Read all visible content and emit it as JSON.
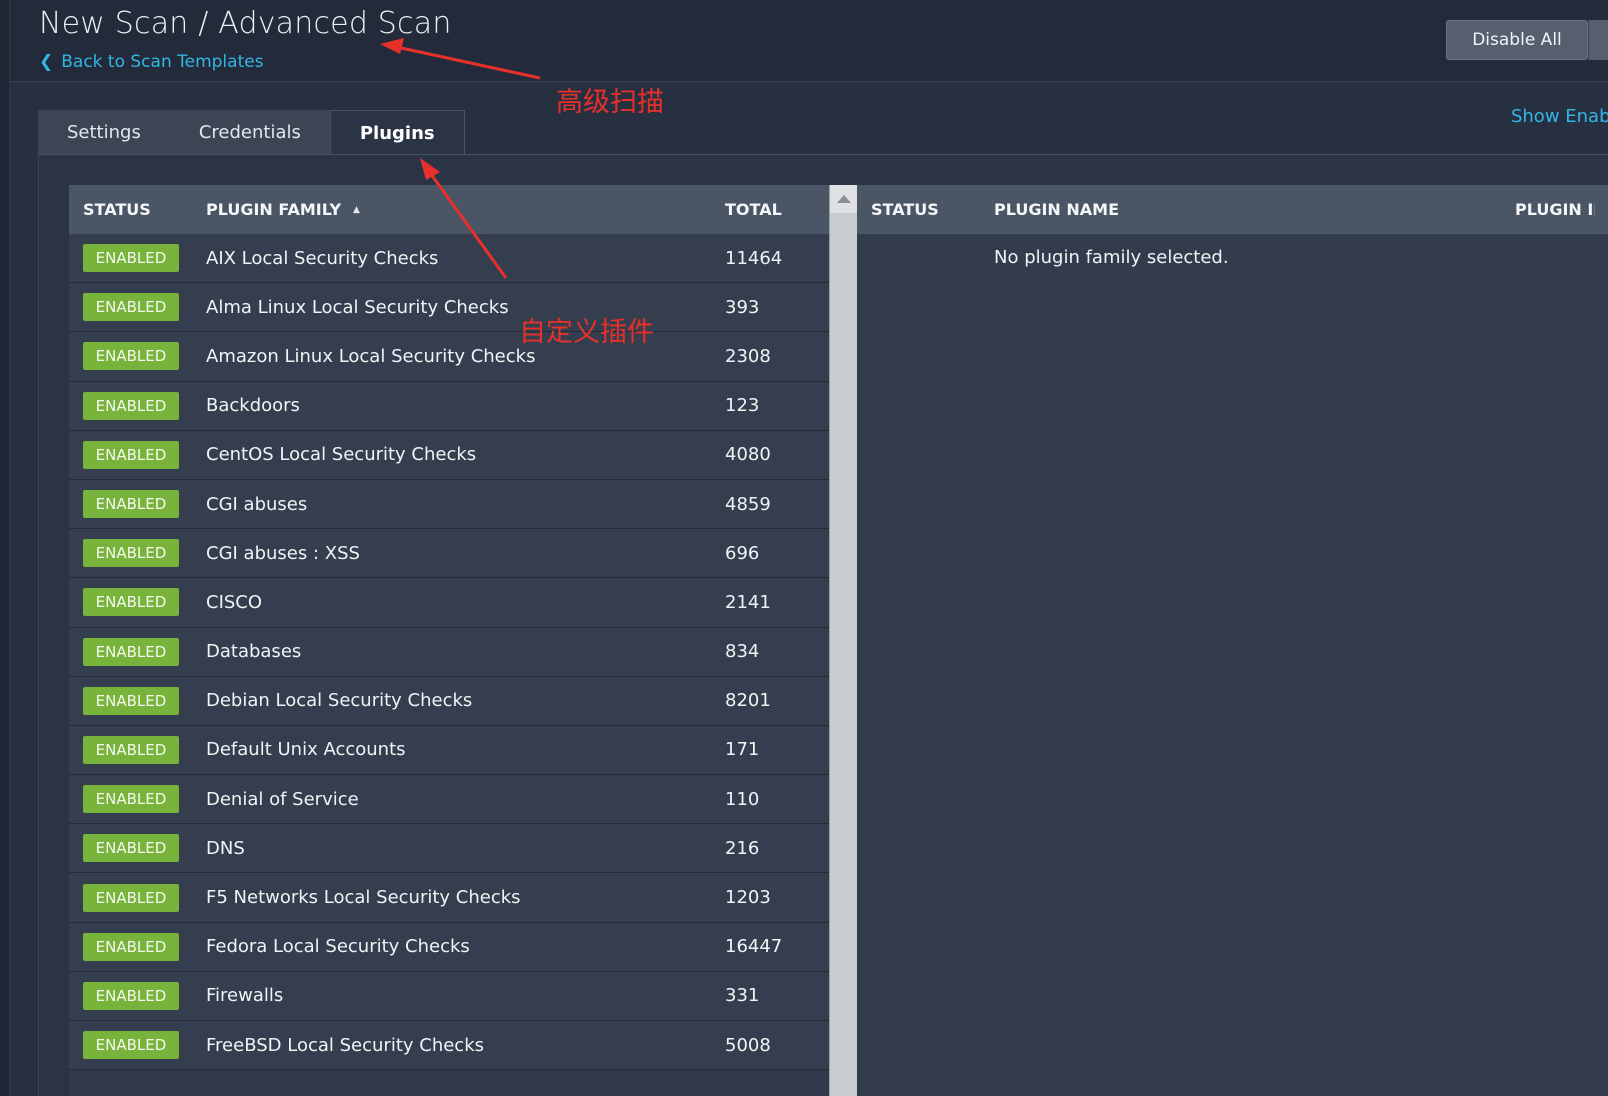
{
  "header": {
    "title": "New Scan / Advanced Scan",
    "back_link": "Back to Scan Templates",
    "disable_all": "Disable All"
  },
  "tabs": [
    {
      "label": "Settings",
      "active": false
    },
    {
      "label": "Credentials",
      "active": false
    },
    {
      "label": "Plugins",
      "active": true
    }
  ],
  "show_enabled": "Show Enabled",
  "families_table": {
    "columns": {
      "status": "STATUS",
      "family": "PLUGIN FAMILY",
      "total": "TOTAL"
    },
    "sort": "ascending",
    "rows": [
      {
        "status": "ENABLED",
        "family": "AIX Local Security Checks",
        "total": "11464"
      },
      {
        "status": "ENABLED",
        "family": "Alma Linux Local Security Checks",
        "total": "393"
      },
      {
        "status": "ENABLED",
        "family": "Amazon Linux Local Security Checks",
        "total": "2308"
      },
      {
        "status": "ENABLED",
        "family": "Backdoors",
        "total": "123"
      },
      {
        "status": "ENABLED",
        "family": "CentOS Local Security Checks",
        "total": "4080"
      },
      {
        "status": "ENABLED",
        "family": "CGI abuses",
        "total": "4859"
      },
      {
        "status": "ENABLED",
        "family": "CGI abuses : XSS",
        "total": "696"
      },
      {
        "status": "ENABLED",
        "family": "CISCO",
        "total": "2141"
      },
      {
        "status": "ENABLED",
        "family": "Databases",
        "total": "834"
      },
      {
        "status": "ENABLED",
        "family": "Debian Local Security Checks",
        "total": "8201"
      },
      {
        "status": "ENABLED",
        "family": "Default Unix Accounts",
        "total": "171"
      },
      {
        "status": "ENABLED",
        "family": "Denial of Service",
        "total": "110"
      },
      {
        "status": "ENABLED",
        "family": "DNS",
        "total": "216"
      },
      {
        "status": "ENABLED",
        "family": "F5 Networks Local Security Checks",
        "total": "1203"
      },
      {
        "status": "ENABLED",
        "family": "Fedora Local Security Checks",
        "total": "16447"
      },
      {
        "status": "ENABLED",
        "family": "Firewalls",
        "total": "331"
      },
      {
        "status": "ENABLED",
        "family": "FreeBSD Local Security Checks",
        "total": "5008"
      }
    ]
  },
  "plugins_table": {
    "columns": {
      "status": "STATUS",
      "name": "PLUGIN NAME",
      "id": "PLUGIN ID"
    },
    "empty_message": "No plugin family selected."
  },
  "annotations": {
    "advanced_scan": "高级扫描",
    "custom_plugins": "自定义插件"
  },
  "colors": {
    "background": "#232b3a",
    "link": "#33b6e6",
    "enabled_badge": "#78b33c",
    "annotation": "#e8302b"
  }
}
